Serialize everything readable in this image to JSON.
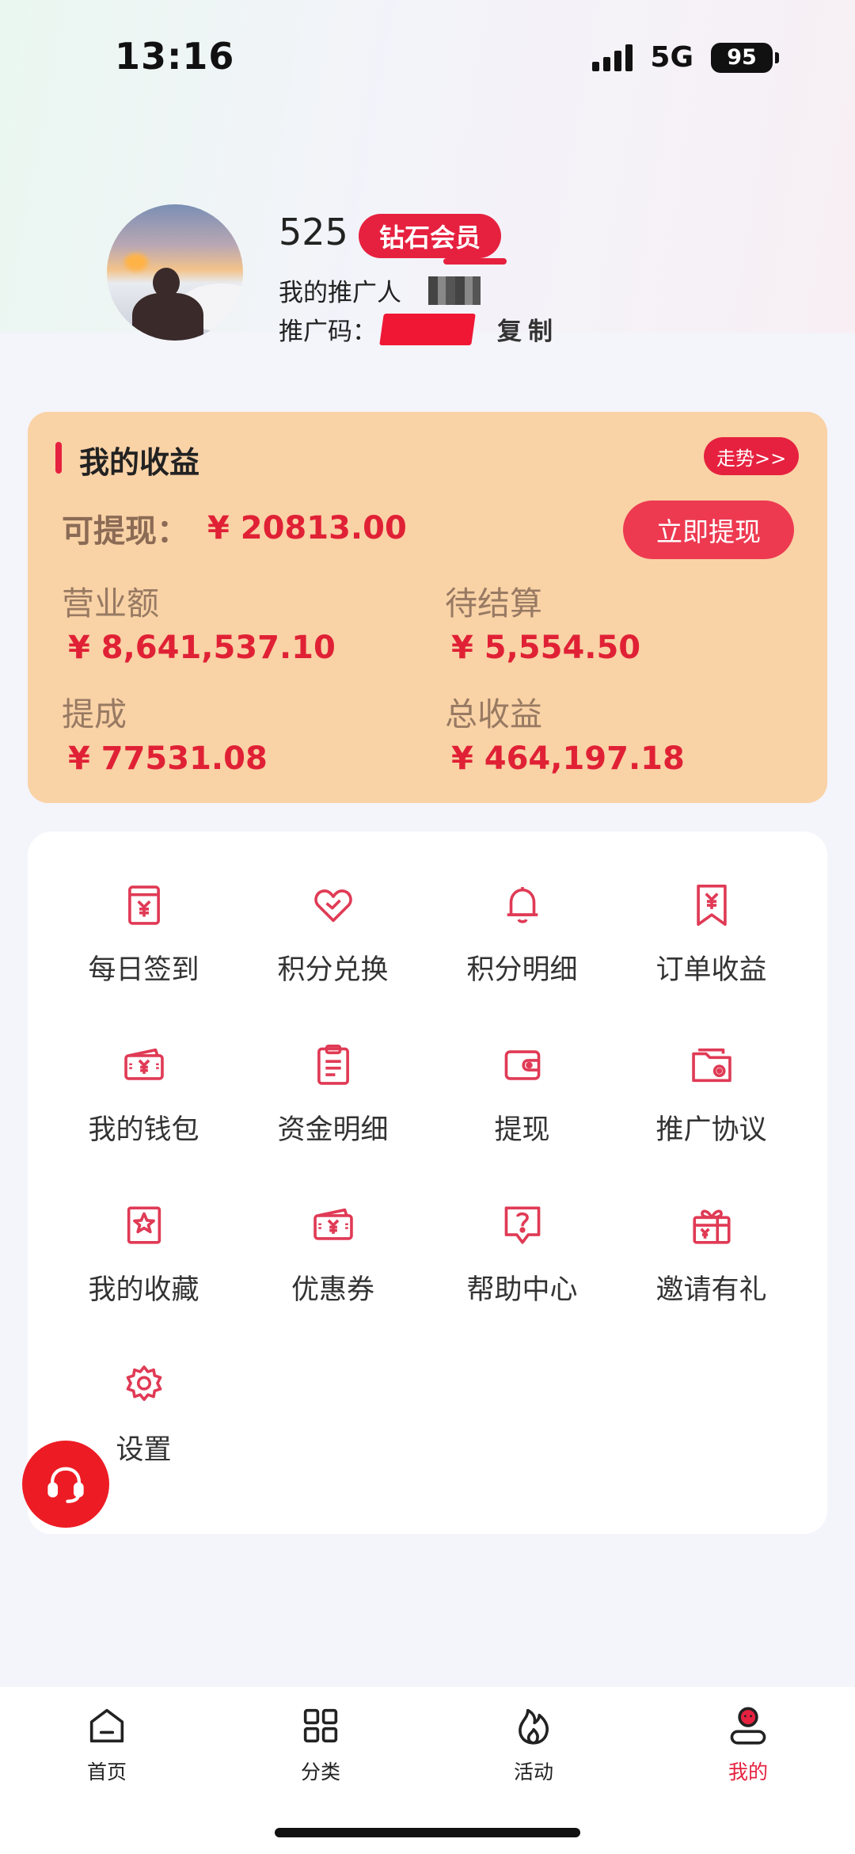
{
  "status_bar": {
    "time": "13:16",
    "network": "5G",
    "battery": "95"
  },
  "profile": {
    "name": "525",
    "level_badge": "钻石会员",
    "promoter_label": "我的推广人",
    "promo_code_label": "推广码：",
    "copy_label": "复制"
  },
  "earnings": {
    "title": "我的收益",
    "trend_button": "走势>>",
    "withdrawable_label": "可提现：",
    "withdrawable_amount": "¥ 20813.00",
    "withdraw_button": "立即提现",
    "stats": [
      {
        "label": "营业额",
        "value": "¥ 8,641,537.10"
      },
      {
        "label": "待结算",
        "value": "¥ 5,554.50"
      },
      {
        "label": "提成",
        "value": "¥ 77531.08"
      },
      {
        "label": "总收益",
        "value": "¥ 464,197.18"
      }
    ]
  },
  "menu": [
    {
      "label": "每日签到",
      "icon": "daily-checkin-icon"
    },
    {
      "label": "积分兑换",
      "icon": "heart-icon"
    },
    {
      "label": "积分明细",
      "icon": "bell-icon"
    },
    {
      "label": "订单收益",
      "icon": "yuan-bookmark-icon"
    },
    {
      "label": "我的钱包",
      "icon": "wallet-ticket-icon"
    },
    {
      "label": "资金明细",
      "icon": "clipboard-icon"
    },
    {
      "label": "提现",
      "icon": "wallet-icon"
    },
    {
      "label": "推广协议",
      "icon": "folder-icon"
    },
    {
      "label": "我的收藏",
      "icon": "star-bookmark-icon"
    },
    {
      "label": "优惠券",
      "icon": "coupon-icon"
    },
    {
      "label": "帮助中心",
      "icon": "help-icon"
    },
    {
      "label": "邀请有礼",
      "icon": "gift-icon"
    },
    {
      "label": "设置",
      "icon": "gear-icon"
    }
  ],
  "bottom_nav": [
    {
      "label": "首页",
      "icon": "home-icon"
    },
    {
      "label": "分类",
      "icon": "category-icon"
    },
    {
      "label": "活动",
      "icon": "flame-icon"
    },
    {
      "label": "我的",
      "icon": "profile-icon",
      "active": true
    }
  ],
  "colors": {
    "accent": "#e6213f",
    "earnings_card": "#f9d2a6",
    "amount": "#e02135"
  }
}
